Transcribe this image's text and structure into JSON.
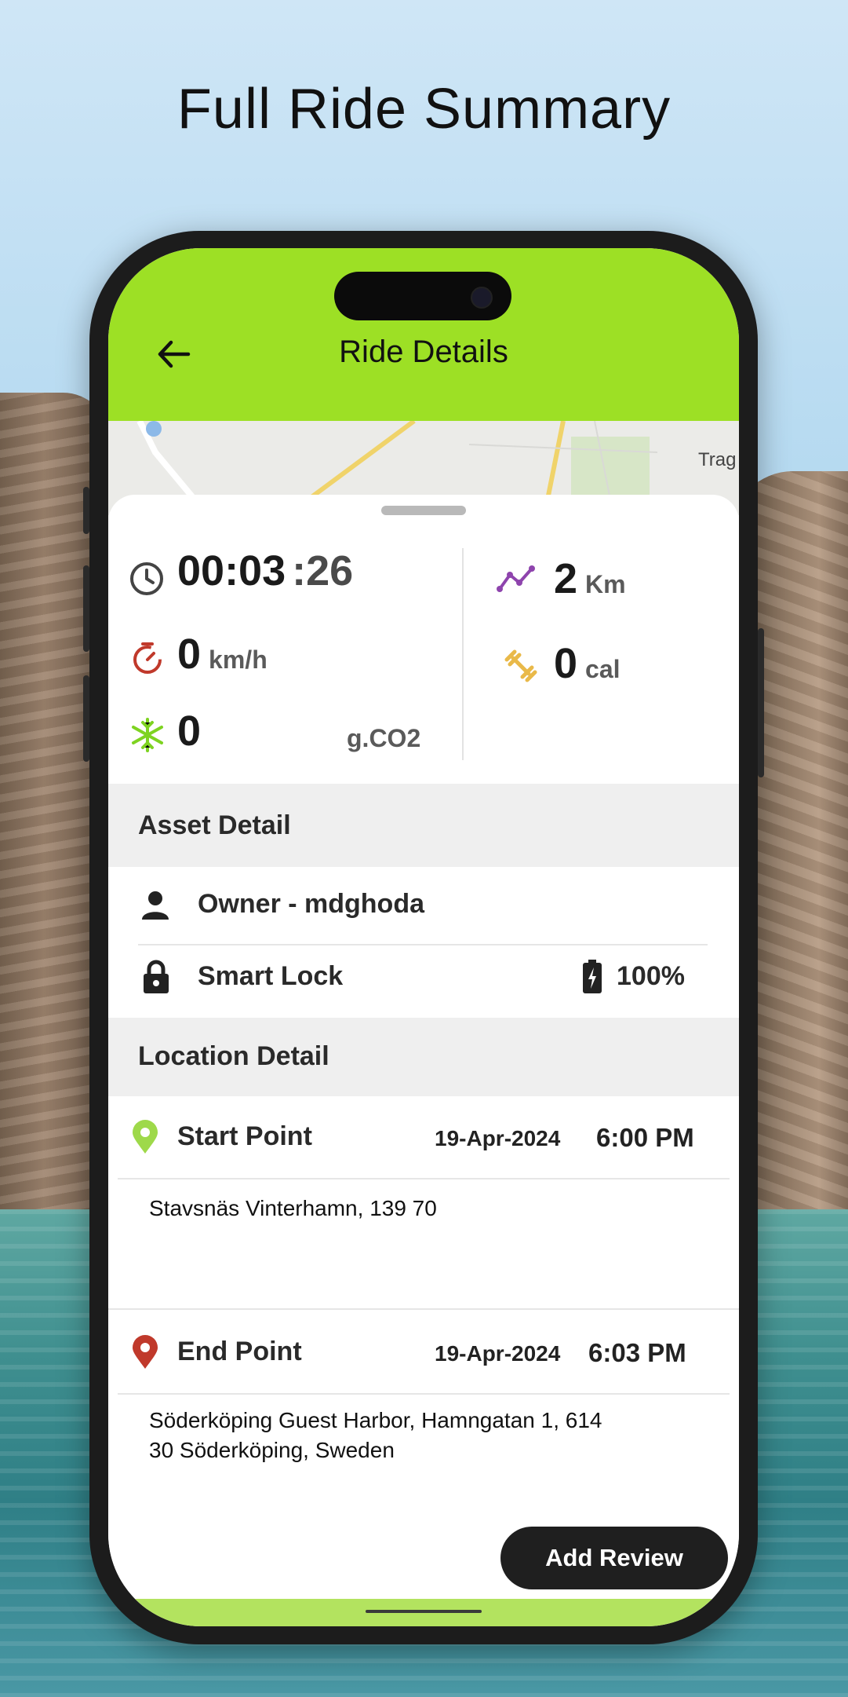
{
  "headline": "Full Ride Summary",
  "app_bar": {
    "title": "Ride Details",
    "back_icon": "arrow-left-icon"
  },
  "map": {
    "place_label": "Trag"
  },
  "stats": {
    "duration_main": "00:03",
    "duration_seconds": ":26",
    "speed_value": "0",
    "speed_unit": "km/h",
    "co2_value": "0",
    "co2_unit": "g.CO2",
    "distance_value": "2",
    "distance_unit": "Km",
    "calories_value": "0",
    "calories_unit": "cal"
  },
  "asset_detail": {
    "heading": "Asset Detail",
    "owner": "Owner - mdghoda",
    "lock": "Smart Lock",
    "battery": "100%"
  },
  "location_detail": {
    "heading": "Location Detail",
    "start": {
      "label": "Start Point",
      "date": "19-Apr-2024",
      "time": "6:00 PM",
      "address": "Stavsnäs Vinterhamn, 139 70"
    },
    "end": {
      "label": "End Point",
      "date": "19-Apr-2024",
      "time": "6:03 PM",
      "address_line1": "Söderköping Guest Harbor, Hamngatan 1, 614",
      "address_line2": "30 Söderköping, Sweden"
    }
  },
  "add_review_label": "Add Review",
  "colors": {
    "accent": "#9de025",
    "start_pin": "#9ed94a",
    "end_pin": "#c0392b",
    "clock": "#444444",
    "speed_icon": "#c0392b",
    "co2_icon": "#7ed321",
    "distance_icon": "#8e44ad",
    "calories_icon": "#e9b949"
  }
}
